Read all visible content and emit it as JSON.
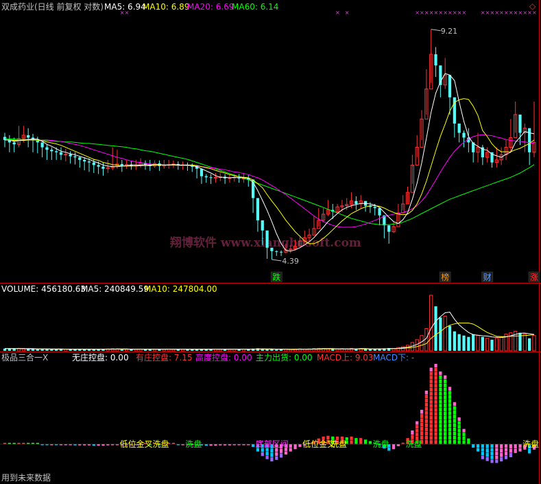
{
  "colors": {
    "background": "#000000",
    "up": "#ff3232",
    "down": "#54fcfc",
    "ma5": "#ffffff",
    "ma10": "#ffff00",
    "ma20": "#ff00ff",
    "ma60": "#00ff00",
    "frame": "#c80000",
    "watermark": "#64203a"
  },
  "header": {
    "title": "双成药业(日线 前复权 对数)",
    "ma": [
      {
        "label": "MA5: 6.94",
        "color": "#ffffff"
      },
      {
        "label": "MA10: 6.89",
        "color": "#ffff00"
      },
      {
        "label": "MA20: 6.69",
        "color": "#ff00ff"
      },
      {
        "label": "MA60: 6.14",
        "color": "#00ff00"
      }
    ]
  },
  "volume_header": [
    {
      "label": "VOLUME: 456180.63",
      "color": "#ffffff"
    },
    {
      "label": "MA5: 240849.59",
      "color": "#ffffff"
    },
    {
      "label": "MA10: 247804.00",
      "color": "#ffff00"
    }
  ],
  "indicator_header": [
    {
      "label": "极品三合一X",
      "color": "#c0c0c0"
    },
    {
      "label": "无庄控盘: 0.00",
      "color": "#ffffff"
    },
    {
      "label": "有庄控盘: 7.15",
      "color": "#ff3232"
    },
    {
      "label": "高度控盘: 0.00",
      "color": "#ff00ff"
    },
    {
      "label": "主力出货: 0.00",
      "color": "#00ff00"
    },
    {
      "label": "MACD上: 9.03",
      "color": "#ff3232"
    },
    {
      "label": "MACD下: -",
      "color": "#3c8cff"
    }
  ],
  "watermark": "翔博软件 www.xiangbosoft.com",
  "footer_note": "用到未来数据",
  "chart_data": {
    "type": "candlestick",
    "scale": "log",
    "price_high_label": "9.21",
    "price_low_label": "4.39",
    "closes": [
      6.45,
      6.4,
      6.36,
      6.48,
      6.55,
      6.5,
      6.44,
      6.4,
      6.3,
      6.25,
      6.22,
      6.2,
      6.15,
      6.16,
      6.12,
      6.1,
      6.05,
      6.02,
      6.0,
      5.95,
      5.92,
      5.88,
      5.9,
      5.93,
      5.97,
      5.94,
      5.96,
      5.93,
      5.95,
      5.99,
      5.96,
      5.93,
      5.98,
      5.93,
      5.95,
      5.96,
      5.97,
      5.94,
      5.95,
      5.93,
      5.92,
      5.88,
      5.74,
      5.72,
      5.71,
      5.72,
      5.73,
      5.7,
      5.71,
      5.72,
      5.7,
      5.7,
      5.68,
      5.35,
      4.98,
      4.82,
      4.56,
      4.51,
      4.5,
      4.49,
      4.53,
      4.54,
      4.58,
      4.66,
      4.71,
      4.75,
      4.85,
      4.98,
      5.08,
      5.15,
      5.12,
      5.2,
      5.22,
      5.24,
      5.3,
      5.25,
      5.3,
      5.22,
      5.2,
      5.18,
      5.06,
      4.9,
      4.8,
      4.88,
      5.1,
      5.25,
      5.45,
      5.95,
      6.3,
      6.9,
      7.6,
      8.5,
      8.2,
      7.7,
      7.95,
      7.4,
      6.8,
      6.6,
      6.5,
      6.4,
      6.2,
      6.3,
      6.1,
      6.2,
      6.0,
      6.05,
      6.15,
      6.3,
      6.5,
      7.0,
      6.6,
      6.7,
      6.2,
      6.4
    ],
    "highs": [
      6.6,
      6.55,
      6.5,
      6.75,
      6.75,
      6.7,
      6.58,
      6.52,
      6.4,
      6.36,
      6.3,
      6.3,
      6.3,
      6.27,
      6.22,
      6.2,
      6.12,
      6.1,
      6.08,
      6.06,
      6.02,
      6.0,
      6.05,
      6.3,
      6.25,
      6.05,
      6.04,
      6.02,
      6.05,
      6.08,
      6.04,
      6.05,
      6.04,
      6.04,
      6.05,
      6.05,
      6.04,
      6.02,
      6.02,
      6.0,
      5.98,
      5.95,
      5.82,
      5.78,
      5.78,
      5.8,
      5.8,
      5.78,
      5.78,
      5.78,
      5.78,
      5.8,
      5.76,
      5.58,
      5.1,
      4.9,
      4.62,
      4.56,
      4.52,
      4.52,
      4.62,
      4.6,
      4.68,
      4.74,
      4.82,
      4.85,
      5.05,
      5.18,
      5.18,
      5.32,
      5.25,
      5.25,
      5.32,
      5.35,
      5.45,
      5.38,
      5.4,
      5.3,
      5.28,
      5.25,
      5.18,
      4.98,
      4.9,
      4.96,
      5.25,
      5.4,
      5.55,
      6.15,
      6.55,
      7.1,
      8.1,
      9.21,
      8.7,
      8.1,
      8.4,
      7.9,
      7.0,
      6.7,
      6.65,
      6.7,
      6.4,
      6.6,
      6.35,
      6.3,
      6.2,
      6.3,
      6.3,
      6.45,
      6.9,
      7.3,
      7.0,
      6.8,
      6.4,
      7.3
    ],
    "lows": [
      6.3,
      6.2,
      6.2,
      6.3,
      6.4,
      6.3,
      6.2,
      6.18,
      6.1,
      6.05,
      6.05,
      6.05,
      6.05,
      6.02,
      5.98,
      5.96,
      5.9,
      5.85,
      5.82,
      5.8,
      5.78,
      5.75,
      5.8,
      5.85,
      5.88,
      5.82,
      5.88,
      5.86,
      5.86,
      5.9,
      5.86,
      5.84,
      5.9,
      5.84,
      5.88,
      5.88,
      5.9,
      5.86,
      5.86,
      5.84,
      5.82,
      5.7,
      5.6,
      5.62,
      5.6,
      5.62,
      5.65,
      5.6,
      5.62,
      5.64,
      5.62,
      5.62,
      5.55,
      5.1,
      4.8,
      4.6,
      4.4,
      4.39,
      4.44,
      4.44,
      4.48,
      4.48,
      4.52,
      4.58,
      4.62,
      4.66,
      4.76,
      4.88,
      4.95,
      5.05,
      5.0,
      5.1,
      5.12,
      5.15,
      5.18,
      5.15,
      5.18,
      5.12,
      5.1,
      5.06,
      4.9,
      4.7,
      4.62,
      4.78,
      4.96,
      5.14,
      5.25,
      5.6,
      6.1,
      6.45,
      7.0,
      7.75,
      7.9,
      7.4,
      7.6,
      7.0,
      6.5,
      6.4,
      6.3,
      6.2,
      6.0,
      6.0,
      5.95,
      6.0,
      5.9,
      5.9,
      5.95,
      6.05,
      6.2,
      6.6,
      6.35,
      6.2,
      5.95,
      6.1
    ],
    "ma5": [
      6.45,
      6.45,
      6.42,
      6.44,
      6.45,
      6.46,
      6.47,
      6.47,
      6.42,
      6.36,
      6.32,
      6.27,
      6.22,
      6.2,
      6.17,
      6.15,
      6.12,
      6.09,
      6.06,
      6.02,
      5.99,
      5.95,
      5.93,
      5.92,
      5.92,
      5.93,
      5.94,
      5.95,
      5.95,
      5.95,
      5.96,
      5.95,
      5.96,
      5.96,
      5.95,
      5.95,
      5.96,
      5.95,
      5.95,
      5.95,
      5.94,
      5.92,
      5.88,
      5.84,
      5.8,
      5.75,
      5.72,
      5.72,
      5.71,
      5.72,
      5.71,
      5.71,
      5.7,
      5.63,
      5.48,
      5.31,
      5.14,
      4.96,
      4.77,
      4.62,
      4.52,
      4.51,
      4.53,
      4.56,
      4.6,
      4.65,
      4.71,
      4.79,
      4.87,
      4.96,
      5.02,
      5.09,
      5.15,
      5.19,
      5.22,
      5.24,
      5.26,
      5.26,
      5.25,
      5.23,
      5.19,
      5.11,
      5.03,
      4.96,
      4.93,
      4.99,
      5.1,
      5.33,
      5.61,
      5.99,
      6.49,
      7.05,
      7.5,
      7.78,
      7.99,
      7.95,
      7.81,
      7.29,
      6.85,
      6.52,
      6.38,
      6.32,
      6.26,
      6.24,
      6.16,
      6.13,
      6.1,
      6.16,
      6.2,
      6.4,
      6.51,
      6.63,
      6.6,
      6.58
    ],
    "ma10": [
      6.45,
      6.45,
      6.44,
      6.44,
      6.44,
      6.45,
      6.45,
      6.45,
      6.43,
      6.41,
      6.39,
      6.37,
      6.34,
      6.3,
      6.26,
      6.22,
      6.18,
      6.14,
      6.1,
      6.06,
      6.04,
      6.0,
      5.98,
      5.96,
      5.95,
      5.93,
      5.93,
      5.93,
      5.93,
      5.94,
      5.94,
      5.94,
      5.95,
      5.95,
      5.95,
      5.95,
      5.95,
      5.95,
      5.95,
      5.95,
      5.95,
      5.94,
      5.92,
      5.9,
      5.88,
      5.85,
      5.82,
      5.8,
      5.77,
      5.75,
      5.73,
      5.72,
      5.71,
      5.67,
      5.6,
      5.53,
      5.41,
      5.3,
      5.2,
      5.09,
      4.98,
      4.89,
      4.8,
      4.73,
      4.66,
      4.62,
      4.62,
      4.65,
      4.7,
      4.76,
      4.83,
      4.9,
      4.97,
      5.03,
      5.09,
      5.13,
      5.17,
      5.2,
      5.22,
      5.22,
      5.21,
      5.18,
      5.14,
      5.11,
      5.08,
      5.07,
      5.08,
      5.14,
      5.25,
      5.42,
      5.65,
      5.93,
      6.23,
      6.53,
      6.79,
      7.08,
      7.28,
      7.34,
      7.37,
      7.35,
      7.19,
      6.98,
      6.65,
      6.52,
      6.37,
      6.27,
      6.21,
      6.21,
      6.21,
      6.25,
      6.28,
      6.33,
      6.38,
      6.45
    ],
    "ma20": [
      6.45,
      6.45,
      6.45,
      6.45,
      6.45,
      6.45,
      6.45,
      6.45,
      6.45,
      6.45,
      6.44,
      6.43,
      6.42,
      6.4,
      6.38,
      6.36,
      6.34,
      6.31,
      6.28,
      6.25,
      6.22,
      6.19,
      6.16,
      6.13,
      6.1,
      6.08,
      6.05,
      6.03,
      6.01,
      6.0,
      5.98,
      5.97,
      5.96,
      5.95,
      5.95,
      5.95,
      5.95,
      5.94,
      5.94,
      5.94,
      5.94,
      5.93,
      5.92,
      5.91,
      5.9,
      5.89,
      5.87,
      5.86,
      5.84,
      5.82,
      5.81,
      5.79,
      5.77,
      5.74,
      5.71,
      5.67,
      5.62,
      5.57,
      5.52,
      5.46,
      5.41,
      5.35,
      5.29,
      5.23,
      5.17,
      5.11,
      5.05,
      5.0,
      4.96,
      4.93,
      4.9,
      4.88,
      4.87,
      4.87,
      4.87,
      4.88,
      4.9,
      4.92,
      4.95,
      4.98,
      5.01,
      5.04,
      5.06,
      5.08,
      5.09,
      5.11,
      5.13,
      5.17,
      5.22,
      5.3,
      5.4,
      5.53,
      5.67,
      5.82,
      5.96,
      6.1,
      6.22,
      6.32,
      6.4,
      6.47,
      6.52,
      6.55,
      6.56,
      6.55,
      6.54,
      6.51,
      6.49,
      6.46,
      6.44,
      6.43,
      6.42,
      6.41,
      6.39,
      6.38
    ],
    "ma60": [
      6.48,
      6.47,
      6.47,
      6.46,
      6.46,
      6.45,
      6.45,
      6.44,
      6.44,
      6.44,
      6.43,
      6.42,
      6.42,
      6.41,
      6.41,
      6.4,
      6.39,
      6.38,
      6.38,
      6.37,
      6.36,
      6.35,
      6.34,
      6.33,
      6.32,
      6.31,
      6.3,
      6.28,
      6.27,
      6.25,
      6.23,
      6.22,
      6.2,
      6.18,
      6.16,
      6.14,
      6.12,
      6.1,
      6.08,
      6.06,
      6.03,
      6.0,
      5.97,
      5.94,
      5.91,
      5.88,
      5.85,
      5.82,
      5.79,
      5.76,
      5.73,
      5.7,
      5.67,
      5.64,
      5.61,
      5.58,
      5.55,
      5.52,
      5.49,
      5.46,
      5.43,
      5.4,
      5.37,
      5.34,
      5.31,
      5.28,
      5.25,
      5.22,
      5.19,
      5.16,
      5.13,
      5.1,
      5.07,
      5.04,
      5.01,
      4.99,
      4.97,
      4.95,
      4.93,
      4.92,
      4.91,
      4.91,
      4.91,
      4.92,
      4.93,
      4.95,
      4.98,
      5.01,
      5.05,
      5.09,
      5.13,
      5.17,
      5.21,
      5.25,
      5.29,
      5.33,
      5.36,
      5.39,
      5.42,
      5.45,
      5.48,
      5.51,
      5.54,
      5.57,
      5.6,
      5.63,
      5.66,
      5.69,
      5.72,
      5.76,
      5.8,
      5.85,
      5.9,
      5.96
    ],
    "volume": [
      0.8,
      0.7,
      0.8,
      0.9,
      0.7,
      0.6,
      0.7,
      0.6,
      0.7,
      0.6,
      0.7,
      0.6,
      0.5,
      0.6,
      0.5,
      0.6,
      0.5,
      0.6,
      0.5,
      0.6,
      0.5,
      0.6,
      0.7,
      0.8,
      0.7,
      0.6,
      0.5,
      0.6,
      0.5,
      0.6,
      0.5,
      0.6,
      0.5,
      0.6,
      0.5,
      0.6,
      0.5,
      0.6,
      0.5,
      0.6,
      0.5,
      0.6,
      0.7,
      0.6,
      0.5,
      0.6,
      0.5,
      0.6,
      0.5,
      0.6,
      0.5,
      0.6,
      0.5,
      0.8,
      0.9,
      0.8,
      0.6,
      0.5,
      0.4,
      0.5,
      0.6,
      0.5,
      0.6,
      0.7,
      0.6,
      0.7,
      0.8,
      0.9,
      0.8,
      0.7,
      0.6,
      0.7,
      0.8,
      0.7,
      0.9,
      0.7,
      0.8,
      0.7,
      0.6,
      0.7,
      0.8,
      0.9,
      1.0,
      0.8,
      1.2,
      1.5,
      2.0,
      3.0,
      4.0,
      5.5,
      8.0,
      20.0,
      16.0,
      12.0,
      12.5,
      9.0,
      7.0,
      6.0,
      5.5,
      5.0,
      6.0,
      5.5,
      5.0,
      4.5,
      4.0,
      4.5,
      5.0,
      6.0,
      6.5,
      7.0,
      6.5,
      6.0,
      4.5,
      5.5
    ],
    "vol_ma5": [
      0.8,
      0.8,
      0.8,
      0.8,
      0.8,
      0.7,
      0.7,
      0.7,
      0.7,
      0.7,
      0.6,
      0.6,
      0.6,
      0.6,
      0.6,
      0.6,
      0.6,
      0.6,
      0.6,
      0.6,
      0.6,
      0.6,
      0.6,
      0.6,
      0.7,
      0.7,
      0.7,
      0.6,
      0.6,
      0.6,
      0.6,
      0.6,
      0.6,
      0.6,
      0.6,
      0.6,
      0.6,
      0.6,
      0.6,
      0.6,
      0.6,
      0.6,
      0.6,
      0.6,
      0.6,
      0.6,
      0.6,
      0.6,
      0.6,
      0.6,
      0.6,
      0.6,
      0.6,
      0.6,
      0.7,
      0.7,
      0.7,
      0.7,
      0.6,
      0.6,
      0.6,
      0.5,
      0.5,
      0.6,
      0.6,
      0.6,
      0.7,
      0.7,
      0.8,
      0.8,
      0.8,
      0.7,
      0.7,
      0.7,
      0.7,
      0.7,
      0.8,
      0.8,
      0.7,
      0.7,
      0.7,
      0.7,
      0.8,
      0.8,
      0.9,
      1.1,
      1.3,
      1.7,
      2.3,
      3.2,
      4.5,
      8.1,
      10.7,
      12.3,
      13.7,
      13.9,
      11.3,
      9.3,
      7.9,
      6.6,
      5.8,
      5.6,
      5.4,
      5.3,
      5.0,
      4.9,
      4.8,
      5.0,
      5.4,
      5.9,
      6.3,
      6.4,
      6.1,
      5.9
    ],
    "vol_ma10": [
      0.8,
      0.8,
      0.8,
      0.8,
      0.8,
      0.8,
      0.8,
      0.7,
      0.7,
      0.7,
      0.7,
      0.7,
      0.7,
      0.6,
      0.6,
      0.6,
      0.6,
      0.6,
      0.6,
      0.6,
      0.6,
      0.6,
      0.6,
      0.6,
      0.6,
      0.6,
      0.6,
      0.6,
      0.6,
      0.6,
      0.6,
      0.6,
      0.6,
      0.6,
      0.6,
      0.6,
      0.6,
      0.6,
      0.6,
      0.6,
      0.6,
      0.6,
      0.6,
      0.6,
      0.6,
      0.6,
      0.6,
      0.6,
      0.6,
      0.6,
      0.6,
      0.6,
      0.6,
      0.6,
      0.6,
      0.6,
      0.6,
      0.6,
      0.6,
      0.6,
      0.6,
      0.6,
      0.6,
      0.6,
      0.6,
      0.6,
      0.6,
      0.6,
      0.7,
      0.7,
      0.7,
      0.7,
      0.7,
      0.7,
      0.7,
      0.7,
      0.7,
      0.7,
      0.7,
      0.7,
      0.7,
      0.7,
      0.8,
      0.8,
      0.8,
      0.9,
      1.0,
      1.2,
      1.5,
      2.0,
      2.6,
      4.5,
      5.8,
      6.9,
      8.3,
      9.2,
      9.7,
      10.0,
      10.0,
      10.0,
      9.6,
      8.7,
      7.6,
      6.6,
      5.9,
      5.2,
      5.1,
      5.1,
      5.2,
      5.3,
      5.4,
      5.5,
      5.6,
      5.8
    ],
    "macd": [
      0.3,
      0.2,
      0.1,
      0.2,
      0.3,
      0.2,
      0.1,
      0.0,
      -0.1,
      -0.2,
      -0.2,
      -0.3,
      -0.3,
      -0.3,
      -0.3,
      -0.4,
      -0.4,
      -0.4,
      -0.4,
      -0.5,
      -0.5,
      -0.5,
      -0.4,
      -0.3,
      -0.2,
      -0.2,
      -0.1,
      -0.1,
      -0.1,
      0.0,
      0.0,
      -0.1,
      0.0,
      -0.1,
      0.0,
      0.0,
      0.0,
      -0.1,
      -0.1,
      -0.1,
      -0.1,
      -0.2,
      -0.4,
      -0.5,
      -0.5,
      -0.5,
      -0.4,
      -0.4,
      -0.4,
      -0.3,
      -0.3,
      -0.3,
      -0.3,
      -0.8,
      -2.0,
      -3.2,
      -4.0,
      -4.6,
      -4.2,
      -3.6,
      -2.8,
      -2.0,
      -1.4,
      -0.8,
      -0.4,
      0.2,
      0.8,
      1.5,
      2.0,
      2.2,
      2.0,
      2.0,
      2.0,
      1.8,
      2.0,
      1.6,
      1.6,
      1.2,
      0.8,
      0.4,
      -0.4,
      -1.2,
      -1.8,
      -1.4,
      -0.6,
      0.4,
      1.6,
      3.6,
      6.0,
      9.0,
      14.0,
      20.0,
      21.0,
      19.0,
      18.0,
      15.0,
      11.0,
      7.0,
      4.0,
      1.5,
      -1.0,
      -2.0,
      -4.0,
      -4.5,
      -5.0,
      -5.0,
      -4.6,
      -4.0,
      -3.5,
      -2.4,
      -2.0,
      -1.5,
      -2.5,
      -1.5
    ]
  },
  "signals_price": [
    {
      "index": 58,
      "label": "跌",
      "color": "#00ff00"
    },
    {
      "index": 94,
      "label": "榜",
      "color": "#ff9900"
    },
    {
      "index": 103,
      "label": "财",
      "color": "#5aa0ff"
    },
    {
      "index": 113,
      "label": "涨",
      "color": "#ff3232"
    }
  ],
  "signals_indicator": [
    {
      "index": 26,
      "label": "低位金叉",
      "color": "#ffff00"
    },
    {
      "index": 33,
      "label": "洗盘",
      "color": "#ffff00"
    },
    {
      "index": 40,
      "label": "洗盘",
      "color": "#00ff00"
    },
    {
      "index": 55,
      "label": "底部区间",
      "color": "#ff33ff"
    },
    {
      "index": 65,
      "label": "低位金叉",
      "color": "#ffff00"
    },
    {
      "index": 71,
      "label": "洗盘",
      "color": "#ffff00"
    },
    {
      "index": 80,
      "label": "洗盘",
      "color": "#00ff00"
    },
    {
      "index": 87,
      "label": "洗盘",
      "color": "#00ff00"
    },
    {
      "index": 112,
      "label": "洗盘",
      "color": "#ffff00"
    }
  ]
}
